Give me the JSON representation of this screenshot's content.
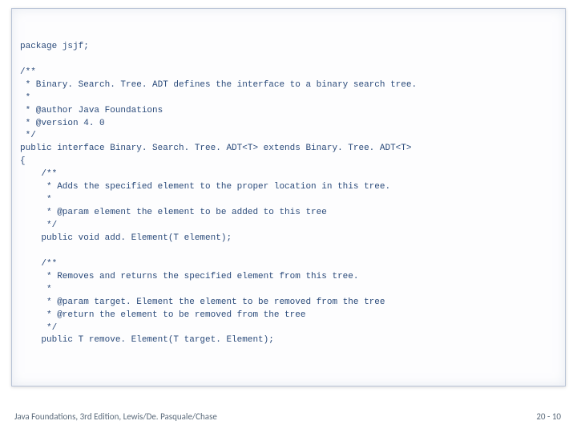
{
  "code": {
    "lines": [
      "package jsjf;",
      "",
      "/**",
      " * Binary. Search. Tree. ADT defines the interface to a binary search tree.",
      " *",
      " * @author Java Foundations",
      " * @version 4. 0",
      " */",
      "public interface Binary. Search. Tree. ADT<T> extends Binary. Tree. ADT<T>",
      "{",
      "    /**",
      "     * Adds the specified element to the proper location in this tree.",
      "     *",
      "     * @param element the element to be added to this tree",
      "     */",
      "    public void add. Element(T element);",
      "",
      "    /**",
      "     * Removes and returns the specified element from this tree.",
      "     *",
      "     * @param target. Element the element to be removed from the tree",
      "     * @return the element to be removed from the tree",
      "     */",
      "    public T remove. Element(T target. Element);"
    ]
  },
  "footer": {
    "left": "Java Foundations, 3rd Edition, Lewis/De. Pasquale/Chase",
    "right": "20 - 10"
  }
}
